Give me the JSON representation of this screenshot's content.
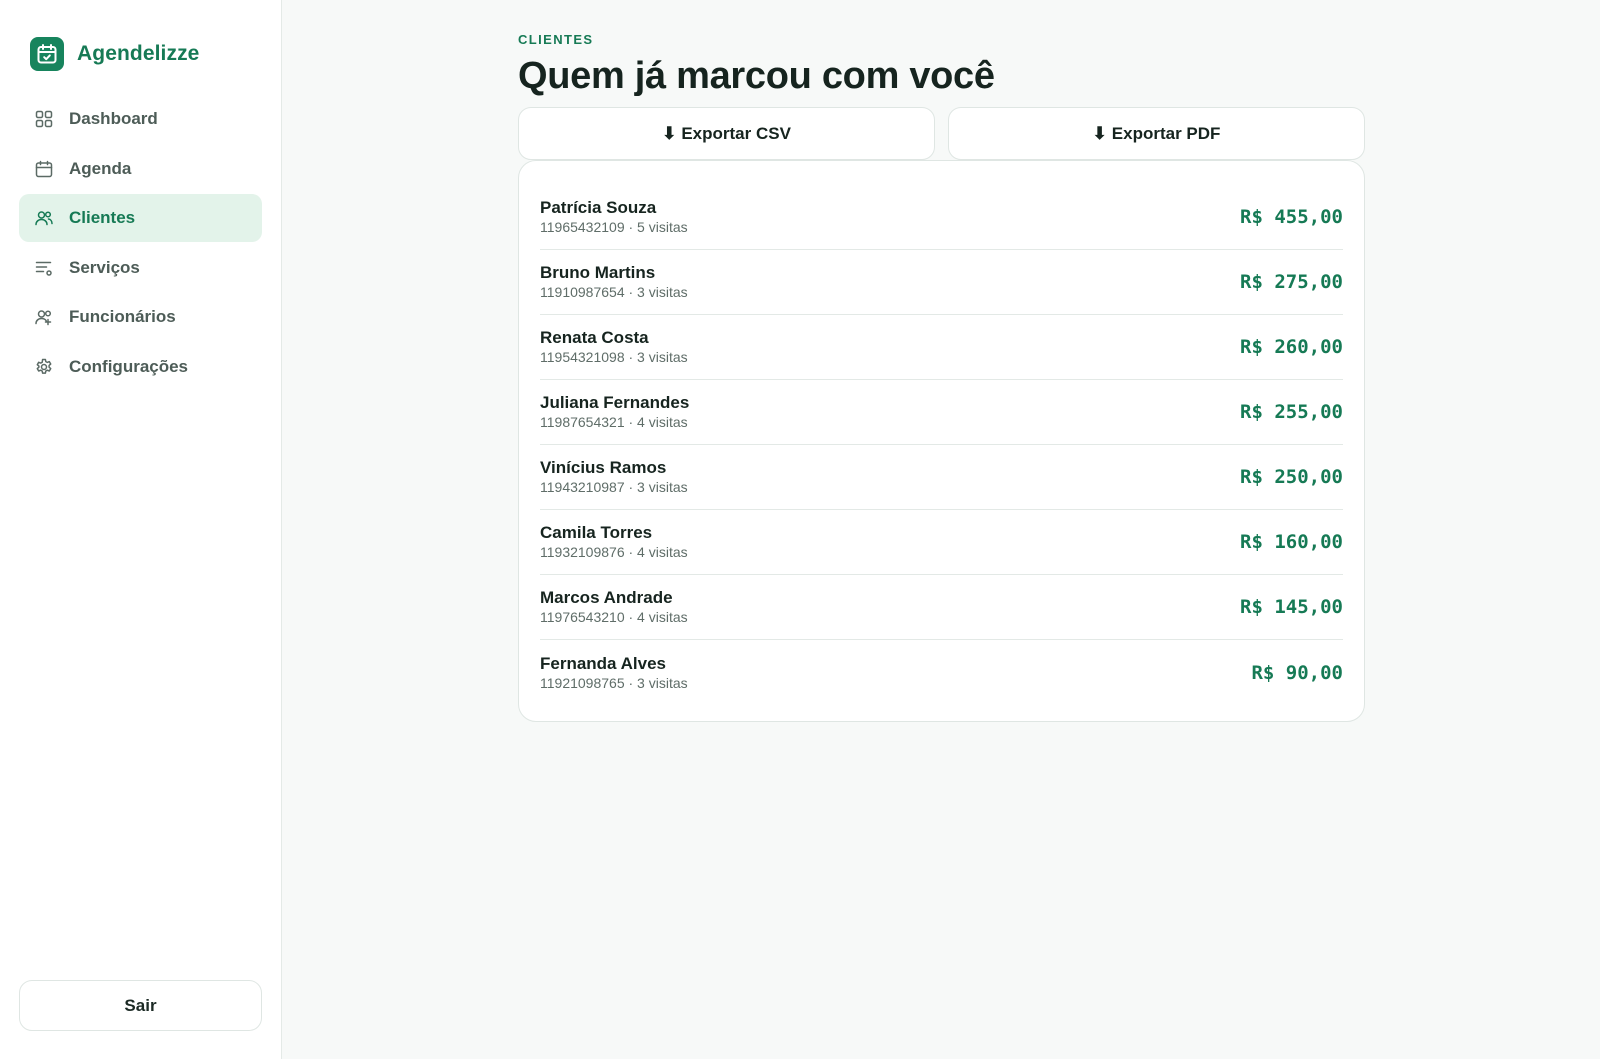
{
  "brand": {
    "name": "Agendelizze",
    "logo_icon": "calendar-check-icon",
    "accent": "#167a55"
  },
  "nav": {
    "items": [
      {
        "label": "Dashboard",
        "icon": "dashboard-grid-icon",
        "active": false
      },
      {
        "label": "Agenda",
        "icon": "calendar-icon",
        "active": false
      },
      {
        "label": "Clientes",
        "icon": "users-icon",
        "active": true
      },
      {
        "label": "Serviços",
        "icon": "services-list-icon",
        "active": false
      },
      {
        "label": "Funcionários",
        "icon": "staff-icon",
        "active": false
      },
      {
        "label": "Configurações",
        "icon": "gear-icon",
        "active": false
      }
    ]
  },
  "logout_label": "Sair",
  "page": {
    "eyebrow": "CLIENTES",
    "title": "Quem já marcou com você"
  },
  "actions": {
    "export_csv": {
      "icon": "⬇",
      "label": "Exportar CSV"
    },
    "export_pdf": {
      "icon": "⬇",
      "label": "Exportar PDF"
    }
  },
  "clients": [
    {
      "name": "Patrícia Souza",
      "meta": "11965432109 · 5 visitas",
      "total": "R$ 455,00"
    },
    {
      "name": "Bruno Martins",
      "meta": "11910987654 · 3 visitas",
      "total": "R$ 275,00"
    },
    {
      "name": "Renata Costa",
      "meta": "11954321098 · 3 visitas",
      "total": "R$ 260,00"
    },
    {
      "name": "Juliana Fernandes",
      "meta": "11987654321 · 4 visitas",
      "total": "R$ 255,00"
    },
    {
      "name": "Vinícius Ramos",
      "meta": "11943210987 · 3 visitas",
      "total": "R$ 250,00"
    },
    {
      "name": "Camila Torres",
      "meta": "11932109876 · 4 visitas",
      "total": "R$ 160,00"
    },
    {
      "name": "Marcos Andrade",
      "meta": "11976543210 · 4 visitas",
      "total": "R$ 145,00"
    },
    {
      "name": "Fernanda Alves",
      "meta": "11921098765 · 3 visitas",
      "total": "R$ 90,00"
    }
  ]
}
